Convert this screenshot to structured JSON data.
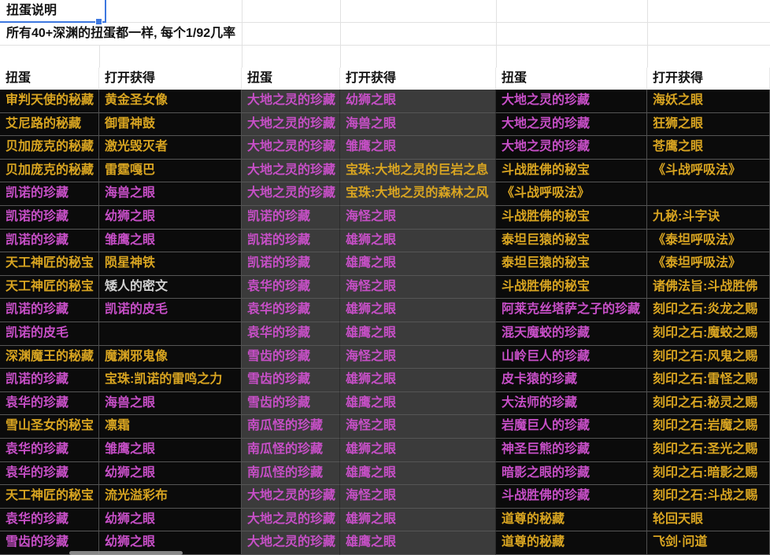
{
  "sheet": {
    "selected_cell_value": "扭蛋说明",
    "note": "所有40+深渊的扭蛋都一样, 每个1/92几率"
  },
  "colors": {
    "selection_blue": "#3d78e0",
    "text_yellow": "#d9a521",
    "text_magenta": "#c74fc7",
    "text_white": "#d2d2d2",
    "dark_cell_bg": "#0b0b0b",
    "gray_cell_bg": "#3b3b3b"
  },
  "table": {
    "headers": [
      "扭蛋",
      "打开获得",
      "扭蛋",
      "打开获得",
      "扭蛋",
      "打开获得"
    ],
    "rows": [
      [
        {
          "t": "审判天使的秘藏",
          "c": "y"
        },
        {
          "t": "黄金圣女像",
          "c": "y"
        },
        {
          "t": "大地之灵的珍藏",
          "c": "m"
        },
        {
          "t": "幼狮之眼",
          "c": "m"
        },
        {
          "t": "大地之灵的珍藏",
          "c": "m"
        },
        {
          "t": "海妖之眼",
          "c": "y"
        }
      ],
      [
        {
          "t": "艾尼路的秘藏",
          "c": "y"
        },
        {
          "t": "御雷神鼓",
          "c": "y"
        },
        {
          "t": "大地之灵的珍藏",
          "c": "m"
        },
        {
          "t": "海兽之眼",
          "c": "m"
        },
        {
          "t": "大地之灵的珍藏",
          "c": "m"
        },
        {
          "t": "狂狮之眼",
          "c": "y"
        }
      ],
      [
        {
          "t": "贝加庞克的秘藏",
          "c": "y"
        },
        {
          "t": "激光毁灭者",
          "c": "y"
        },
        {
          "t": "大地之灵的珍藏",
          "c": "m"
        },
        {
          "t": "雏鹰之眼",
          "c": "m"
        },
        {
          "t": "大地之灵的珍藏",
          "c": "m"
        },
        {
          "t": "苍鹰之眼",
          "c": "y"
        }
      ],
      [
        {
          "t": "贝加庞克的秘藏",
          "c": "y"
        },
        {
          "t": "雷霆嘎巴",
          "c": "y"
        },
        {
          "t": "大地之灵的珍藏",
          "c": "m"
        },
        {
          "t": "宝珠:大地之灵的巨岩之息",
          "c": "y"
        },
        {
          "t": "斗战胜佛的秘宝",
          "c": "y"
        },
        {
          "t": "《斗战呼吸法》",
          "c": "y"
        }
      ],
      [
        {
          "t": "凯诺的珍藏",
          "c": "m"
        },
        {
          "t": "海兽之眼",
          "c": "m"
        },
        {
          "t": "大地之灵的珍藏",
          "c": "m"
        },
        {
          "t": "宝珠:大地之灵的森林之风",
          "c": "y"
        },
        {
          "t": "《斗战呼吸法》",
          "c": "y"
        },
        {
          "t": "",
          "c": ""
        }
      ],
      [
        {
          "t": "凯诺的珍藏",
          "c": "m"
        },
        {
          "t": "幼狮之眼",
          "c": "m"
        },
        {
          "t": "凯诺的珍藏",
          "c": "m"
        },
        {
          "t": "海怪之眼",
          "c": "m"
        },
        {
          "t": "斗战胜佛的秘宝",
          "c": "y"
        },
        {
          "t": "九秘:斗字诀",
          "c": "y"
        }
      ],
      [
        {
          "t": "凯诺的珍藏",
          "c": "m"
        },
        {
          "t": "雏鹰之眼",
          "c": "m"
        },
        {
          "t": "凯诺的珍藏",
          "c": "m"
        },
        {
          "t": "雄狮之眼",
          "c": "m"
        },
        {
          "t": "泰坦巨猿的秘宝",
          "c": "y"
        },
        {
          "t": "《泰坦呼吸法》",
          "c": "y"
        }
      ],
      [
        {
          "t": "天工神匠的秘宝",
          "c": "y"
        },
        {
          "t": "陨星神铁",
          "c": "y"
        },
        {
          "t": "凯诺的珍藏",
          "c": "m"
        },
        {
          "t": "雄鹰之眼",
          "c": "m"
        },
        {
          "t": "泰坦巨猿的秘宝",
          "c": "y"
        },
        {
          "t": "《泰坦呼吸法》",
          "c": "y"
        }
      ],
      [
        {
          "t": "天工神匠的秘宝",
          "c": "y"
        },
        {
          "t": "矮人的密文",
          "c": "w"
        },
        {
          "t": "袁华的珍藏",
          "c": "m"
        },
        {
          "t": "海怪之眼",
          "c": "m"
        },
        {
          "t": "斗战胜佛的秘宝",
          "c": "y"
        },
        {
          "t": "诸佛法旨:斗战胜佛",
          "c": "y"
        }
      ],
      [
        {
          "t": "凯诺的珍藏",
          "c": "m"
        },
        {
          "t": "凯诺的皮毛",
          "c": "m"
        },
        {
          "t": "袁华的珍藏",
          "c": "m"
        },
        {
          "t": "雄狮之眼",
          "c": "m"
        },
        {
          "t": "阿莱克丝塔萨之子的珍藏",
          "c": "m"
        },
        {
          "t": "刻印之石:炎龙之赐",
          "c": "y"
        }
      ],
      [
        {
          "t": "凯诺的皮毛",
          "c": "m"
        },
        {
          "t": "",
          "c": ""
        },
        {
          "t": "袁华的珍藏",
          "c": "m"
        },
        {
          "t": "雄鹰之眼",
          "c": "m"
        },
        {
          "t": "混天魔蛟的珍藏",
          "c": "m"
        },
        {
          "t": "刻印之石:魔蛟之赐",
          "c": "y"
        }
      ],
      [
        {
          "t": "深渊魔王的秘藏",
          "c": "y"
        },
        {
          "t": "魔渊邪鬼像",
          "c": "y"
        },
        {
          "t": "雪齿的珍藏",
          "c": "m"
        },
        {
          "t": "海怪之眼",
          "c": "m"
        },
        {
          "t": "山岭巨人的珍藏",
          "c": "m"
        },
        {
          "t": "刻印之石:风鬼之赐",
          "c": "y"
        }
      ],
      [
        {
          "t": "凯诺的珍藏",
          "c": "m"
        },
        {
          "t": "宝珠:凯诺的雷鸣之力",
          "c": "y"
        },
        {
          "t": "雪齿的珍藏",
          "c": "m"
        },
        {
          "t": "雄狮之眼",
          "c": "m"
        },
        {
          "t": "皮卡猿的珍藏",
          "c": "m"
        },
        {
          "t": "刻印之石:雷怪之赐",
          "c": "y"
        }
      ],
      [
        {
          "t": "袁华的珍藏",
          "c": "m"
        },
        {
          "t": "海兽之眼",
          "c": "m"
        },
        {
          "t": "雪齿的珍藏",
          "c": "m"
        },
        {
          "t": "雄鹰之眼",
          "c": "m"
        },
        {
          "t": "大法师的珍藏",
          "c": "m"
        },
        {
          "t": "刻印之石:秘灵之赐",
          "c": "y"
        }
      ],
      [
        {
          "t": "雪山圣女的秘宝",
          "c": "y"
        },
        {
          "t": "凛霜",
          "c": "y"
        },
        {
          "t": "南瓜怪的珍藏",
          "c": "m"
        },
        {
          "t": "海怪之眼",
          "c": "m"
        },
        {
          "t": "岩魔巨人的珍藏",
          "c": "m"
        },
        {
          "t": "刻印之石:岩魔之赐",
          "c": "y"
        }
      ],
      [
        {
          "t": "袁华的珍藏",
          "c": "m"
        },
        {
          "t": "雏鹰之眼",
          "c": "m"
        },
        {
          "t": "南瓜怪的珍藏",
          "c": "m"
        },
        {
          "t": "雄狮之眼",
          "c": "m"
        },
        {
          "t": "神圣巨熊的珍藏",
          "c": "m"
        },
        {
          "t": "刻印之石:圣光之赐",
          "c": "y"
        }
      ],
      [
        {
          "t": "袁华的珍藏",
          "c": "m"
        },
        {
          "t": "幼狮之眼",
          "c": "m"
        },
        {
          "t": "南瓜怪的珍藏",
          "c": "m"
        },
        {
          "t": "雄鹰之眼",
          "c": "m"
        },
        {
          "t": "暗影之眼的珍藏",
          "c": "m"
        },
        {
          "t": "刻印之石:暗影之赐",
          "c": "y"
        }
      ],
      [
        {
          "t": "天工神匠的秘宝",
          "c": "y"
        },
        {
          "t": "流光溢彩布",
          "c": "y"
        },
        {
          "t": "大地之灵的珍藏",
          "c": "m"
        },
        {
          "t": "海怪之眼",
          "c": "m"
        },
        {
          "t": "斗战胜佛的珍藏",
          "c": "m"
        },
        {
          "t": "刻印之石:斗战之赐",
          "c": "y"
        }
      ],
      [
        {
          "t": "袁华的珍藏",
          "c": "m"
        },
        {
          "t": "幼狮之眼",
          "c": "m"
        },
        {
          "t": "大地之灵的珍藏",
          "c": "m"
        },
        {
          "t": "雄狮之眼",
          "c": "m"
        },
        {
          "t": "道尊的秘藏",
          "c": "y"
        },
        {
          "t": "轮回天眼",
          "c": "y"
        }
      ],
      [
        {
          "t": "雪齿的珍藏",
          "c": "m"
        },
        {
          "t": "幼狮之眼",
          "c": "m"
        },
        {
          "t": "大地之灵的珍藏",
          "c": "m"
        },
        {
          "t": "雄鹰之眼",
          "c": "m"
        },
        {
          "t": "道尊的秘藏",
          "c": "y"
        },
        {
          "t": "飞剑·问道",
          "c": "y"
        }
      ]
    ]
  }
}
